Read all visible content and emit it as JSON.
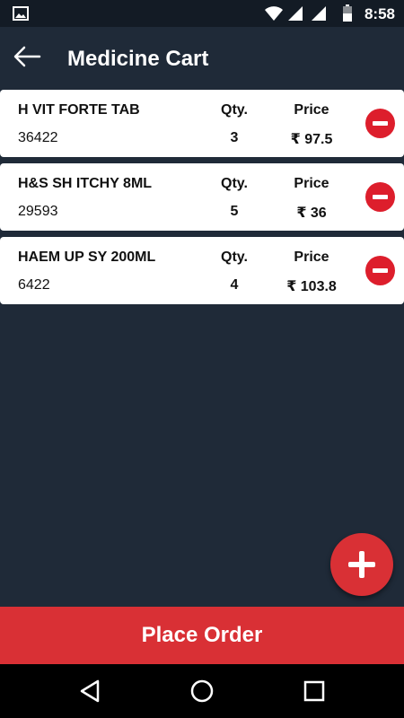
{
  "status_bar": {
    "time": "8:58",
    "icons": [
      "gallery-icon",
      "wifi-icon",
      "signal-icon",
      "signal-icon",
      "battery-icon"
    ]
  },
  "app_bar": {
    "title": "Medicine Cart",
    "back_icon": "arrow-left-icon"
  },
  "cart": {
    "qty_label": "Qty.",
    "price_label": "Price",
    "items": [
      {
        "name": "H VIT FORTE TAB",
        "code": "36422",
        "qty": "3",
        "price": "₹ 97.5"
      },
      {
        "name": "H&S SH ITCHY 8ML",
        "code": "29593",
        "qty": "5",
        "price": "₹ 36"
      },
      {
        "name": "HAEM UP SY 200ML",
        "code": "6422",
        "qty": "4",
        "price": "₹ 103.8"
      }
    ]
  },
  "fab": {
    "icon": "plus-icon"
  },
  "footer": {
    "place_order_label": "Place Order"
  },
  "nav_bar": {
    "icons": [
      "nav-back-icon",
      "nav-home-icon",
      "nav-recent-icon"
    ]
  },
  "colors": {
    "background": "#1f2a38",
    "status_bar": "#131b25",
    "accent_red": "#d93035",
    "remove_red": "#dd1e2c",
    "card": "#ffffff"
  }
}
